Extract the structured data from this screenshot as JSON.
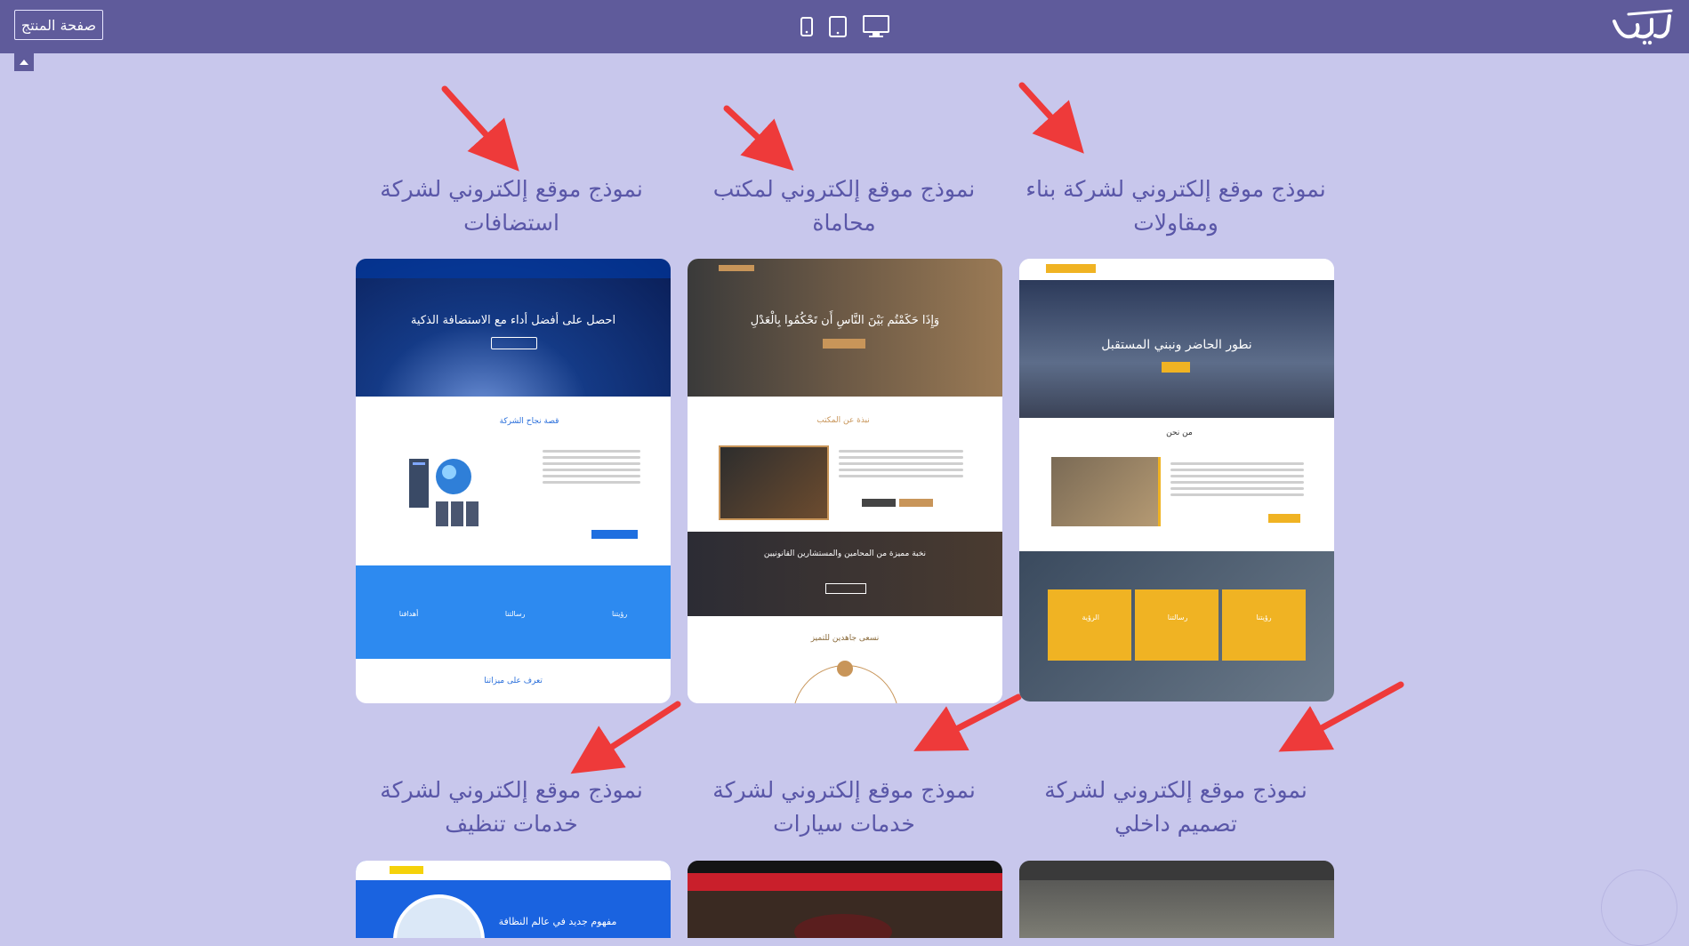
{
  "header": {
    "product_page_label": "صفحة المنتج",
    "devices": [
      "mobile-icon",
      "tablet-icon",
      "desktop-icon"
    ],
    "logo": "brand-logo"
  },
  "templates": [
    {
      "title": "نموذج موقع إلكتروني لشركة استضافات",
      "theme": "hosting",
      "hero_text": "احصل على أفضل أداء مع الاستضافة الذكية",
      "section_title": "قصة نجاح الشركة",
      "values": [
        "رؤيتنا",
        "رسالتنا",
        "أهدافنا"
      ],
      "footer_title": "تعرف على ميزاتنا"
    },
    {
      "title": "نموذج موقع إلكتروني لمكتب محاماة",
      "theme": "law",
      "hero_text": "وَإِذَا حَكَمْتُم بَيْنَ النَّاسِ أَن تَحْكُمُوا بِالْعَدْلِ",
      "section_title": "نبذة عن المكتب",
      "band_title": "نخبة مميزة من المحامين والمستشارين القانونيين",
      "footer_title": "نسعى جاهدين للتميز"
    },
    {
      "title": "نموذج موقع إلكتروني لشركة بناء ومقاولات",
      "theme": "construction",
      "hero_text": "نطور الحاضر ونبني المستقبل",
      "section_title": "من نحن",
      "values": [
        "رؤيتنا",
        "رسالتنا",
        "الرؤية"
      ]
    },
    {
      "title": "نموذج موقع إلكتروني لشركة خدمات تنظيف",
      "theme": "cleaning",
      "hero_text": "مفهوم جديد في عالم النظافة"
    },
    {
      "title": "نموذج موقع إلكتروني لشركة خدمات سيارات",
      "theme": "cars"
    },
    {
      "title": "نموذج موقع إلكتروني لشركة تصميم داخلي",
      "theme": "interior"
    }
  ],
  "colors": {
    "background": "#c8c7ec",
    "topbar": "#5f5b9b",
    "caption": "#5a57a8",
    "arrow": "#ee3a3a"
  }
}
